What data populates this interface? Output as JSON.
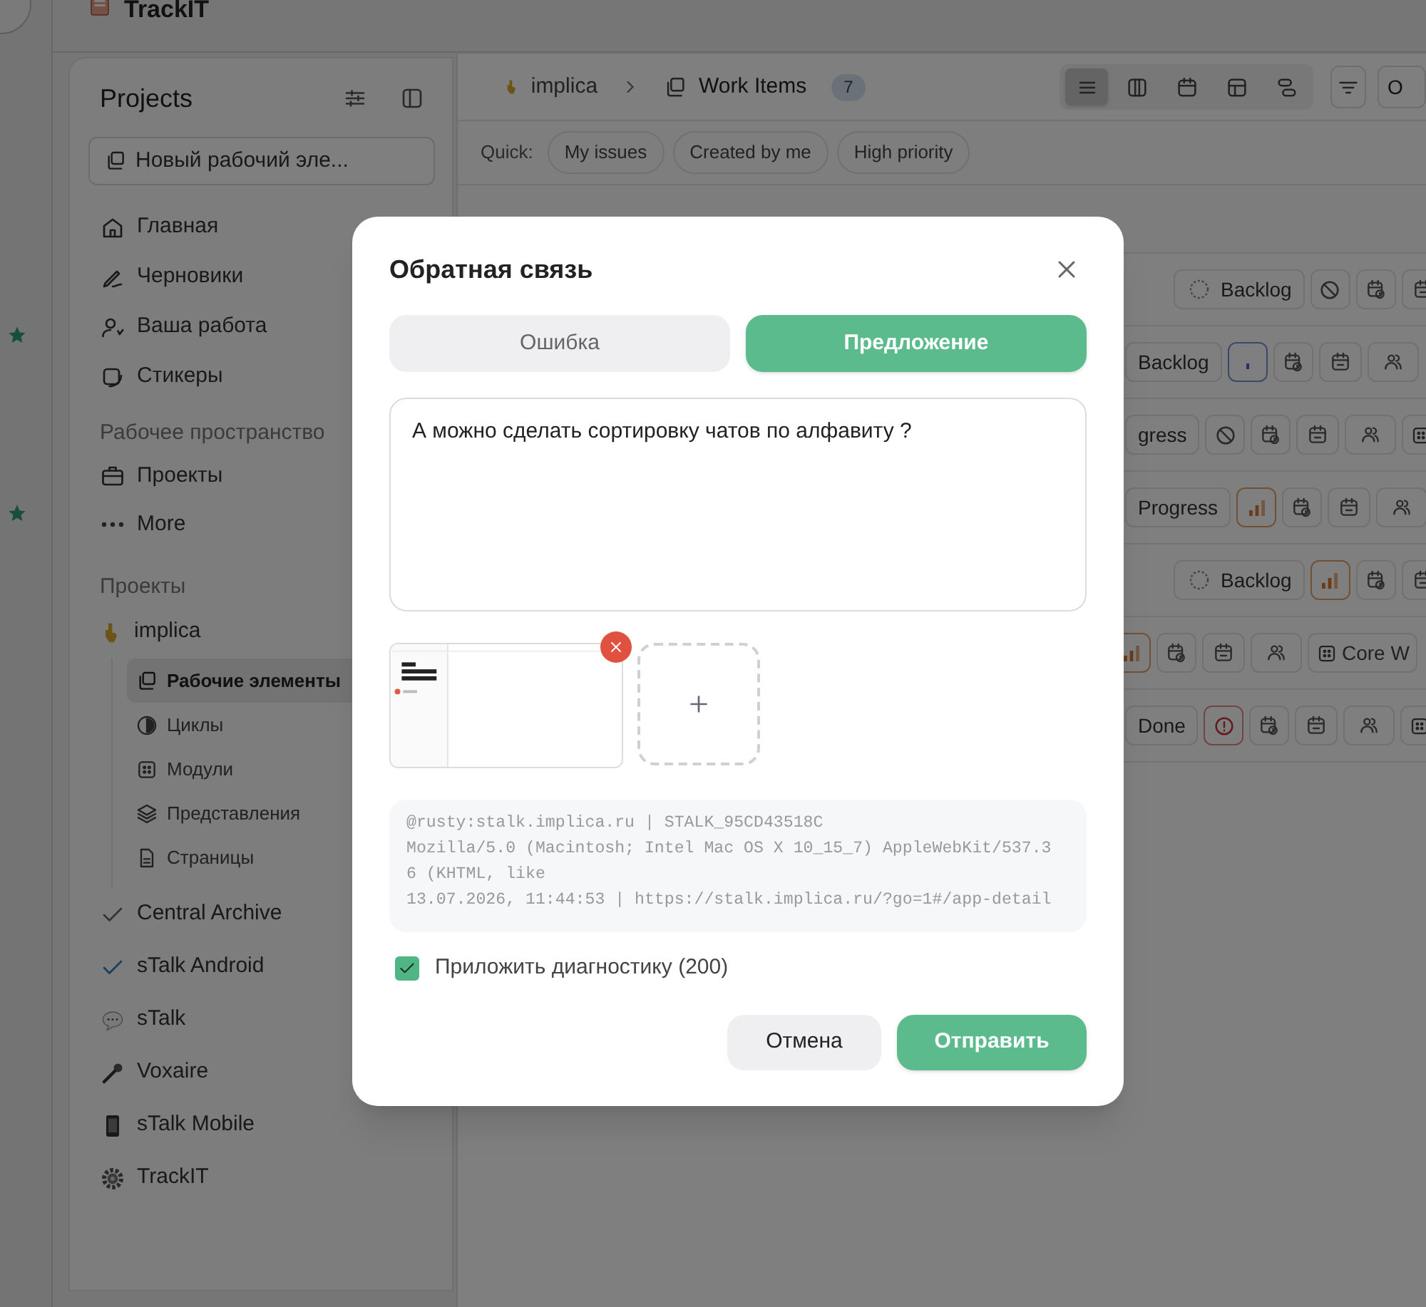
{
  "app_bar": {
    "title": "TrackIT"
  },
  "sidebar": {
    "title": "Projects",
    "new_item_button": "Новый рабочий эле...",
    "nav": [
      {
        "label": "Главная"
      },
      {
        "label": "Черновики"
      },
      {
        "label": "Ваша работа"
      },
      {
        "label": "Стикеры"
      }
    ],
    "workspace_label": "Рабочее пространство",
    "workspace_items": [
      {
        "label": "Проекты"
      },
      {
        "label": "More"
      }
    ],
    "projects_label": "Проекты",
    "projects": [
      {
        "label": "implica",
        "expanded": true,
        "children": [
          {
            "label": "Рабочие элементы",
            "selected": true
          },
          {
            "label": "Циклы",
            "selected": false
          },
          {
            "label": "Модули",
            "selected": false
          },
          {
            "label": "Представления",
            "selected": false
          },
          {
            "label": "Страницы",
            "selected": false
          }
        ]
      },
      {
        "label": "Central Archive",
        "expanded": false
      },
      {
        "label": "sTalk Android",
        "expanded": false
      },
      {
        "label": "sTalk",
        "expanded": false
      },
      {
        "label": "Voxaire",
        "expanded": false
      },
      {
        "label": "sTalk Mobile",
        "expanded": false
      },
      {
        "label": "TrackIT",
        "expanded": false
      }
    ]
  },
  "header": {
    "breadcrumb": [
      "implica",
      "Work Items"
    ],
    "count": "7",
    "layouts": [
      {
        "selected": true
      },
      {
        "selected": false
      },
      {
        "selected": false
      },
      {
        "selected": false
      },
      {
        "selected": false
      }
    ],
    "display_button": "O"
  },
  "quick": {
    "label": "Quick:",
    "chips": [
      "My issues",
      "Created by me",
      "High priority"
    ]
  },
  "rows": [
    {
      "chips": [
        {
          "kind": "state",
          "label": "Backlog",
          "icon": true
        },
        {
          "kind": "no_priority"
        },
        {
          "kind": "start_date"
        },
        {
          "kind": "due_date"
        }
      ]
    },
    {
      "chips": [
        {
          "kind": "state",
          "label": "Backlog",
          "icon": false
        },
        {
          "kind": "low_priority"
        },
        {
          "kind": "start_date"
        },
        {
          "kind": "due_date"
        },
        {
          "kind": "assignee"
        }
      ]
    },
    {
      "chips": [
        {
          "kind": "state",
          "label": "gress",
          "icon": false
        },
        {
          "kind": "no_priority"
        },
        {
          "kind": "start_date"
        },
        {
          "kind": "due_date"
        },
        {
          "kind": "assignee"
        },
        {
          "kind": "module"
        }
      ]
    },
    {
      "chips": [
        {
          "kind": "state",
          "label": "Progress",
          "icon": false
        },
        {
          "kind": "medium_priority"
        },
        {
          "kind": "start_date"
        },
        {
          "kind": "due_date"
        },
        {
          "kind": "assignee"
        }
      ]
    },
    {
      "chips": [
        {
          "kind": "state",
          "label": "Backlog",
          "icon": true
        },
        {
          "kind": "medium_priority"
        },
        {
          "kind": "start_date"
        },
        {
          "kind": "due_date"
        }
      ]
    },
    {
      "chips": [
        {
          "kind": "medium_priority"
        },
        {
          "kind": "start_date"
        },
        {
          "kind": "due_date"
        },
        {
          "kind": "assignee"
        },
        {
          "kind": "module",
          "label": "Core W"
        }
      ]
    },
    {
      "chips": [
        {
          "kind": "state",
          "label": "Done",
          "icon": false
        },
        {
          "kind": "urgent_priority"
        },
        {
          "kind": "start_date"
        },
        {
          "kind": "due_date"
        },
        {
          "kind": "assignee"
        },
        {
          "kind": "module"
        }
      ]
    }
  ],
  "modal": {
    "title": "Обратная связь",
    "tabs": [
      {
        "label": "Ошибка",
        "selected": false
      },
      {
        "label": "Предложение",
        "selected": true
      }
    ],
    "message": "А можно сделать сортировку чатов по алфавиту ?",
    "attachments": [
      {
        "kind": "screenshot"
      }
    ],
    "diagnostics": [
      "@rusty:stalk.implica.ru | STALK_95CD43518C",
      "Mozilla/5.0 (Macintosh; Intel Mac OS X 10_15_7) AppleWebKit/537.3",
      "6 (KHTML, like",
      "13.07.2026, 11:44:53 | https://stalk.implica.ru/?go=1#/app-detail"
    ],
    "attach_diagnostics": {
      "label": "Приложить диагностику (200)",
      "checked": true
    },
    "buttons": [
      {
        "label": "Отмена",
        "kind": "secondary"
      },
      {
        "label": "Отправить",
        "kind": "primary"
      }
    ]
  }
}
